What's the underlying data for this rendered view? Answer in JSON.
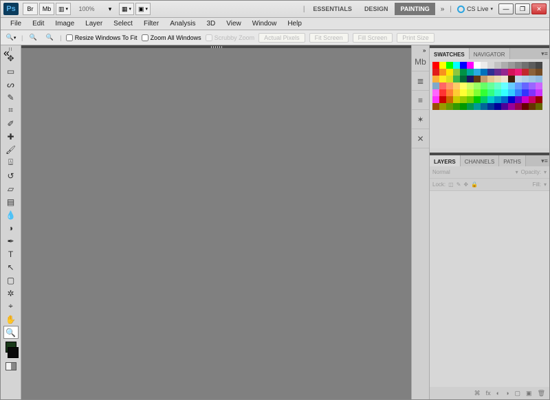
{
  "app": {
    "logo": "Ps"
  },
  "titlebar": {
    "zoom_value": "100%",
    "workspaces": [
      "ESSENTIALS",
      "DESIGN",
      "PAINTING"
    ],
    "active_workspace": 2,
    "cslive_label": "CS Live"
  },
  "menus": [
    "File",
    "Edit",
    "Image",
    "Layer",
    "Select",
    "Filter",
    "Analysis",
    "3D",
    "View",
    "Window",
    "Help"
  ],
  "options": {
    "resize_label": "Resize Windows To Fit",
    "zoom_all_label": "Zoom All Windows",
    "scrubby_label": "Scrubby Zoom",
    "buttons": [
      "Actual Pixels",
      "Fit Screen",
      "Fill Screen",
      "Print Size"
    ]
  },
  "tools": {
    "items": [
      {
        "name": "move-tool",
        "glyph": "✥"
      },
      {
        "name": "marquee-tool",
        "glyph": "▭"
      },
      {
        "name": "lasso-tool",
        "glyph": "ᔕ"
      },
      {
        "name": "quick-select-tool",
        "glyph": "✎"
      },
      {
        "name": "crop-tool",
        "glyph": "⌗"
      },
      {
        "name": "eyedropper-tool",
        "glyph": "✐"
      },
      {
        "name": "healing-tool",
        "glyph": "✚"
      },
      {
        "name": "brush-tool",
        "glyph": "🖌"
      },
      {
        "name": "stamp-tool",
        "glyph": "⍍"
      },
      {
        "name": "history-brush-tool",
        "glyph": "↺"
      },
      {
        "name": "eraser-tool",
        "glyph": "▱"
      },
      {
        "name": "gradient-tool",
        "glyph": "▤"
      },
      {
        "name": "blur-tool",
        "glyph": "💧"
      },
      {
        "name": "dodge-tool",
        "glyph": "◑"
      },
      {
        "name": "pen-tool",
        "glyph": "✒"
      },
      {
        "name": "type-tool",
        "glyph": "T"
      },
      {
        "name": "path-select-tool",
        "glyph": "↖"
      },
      {
        "name": "shape-tool",
        "glyph": "▢"
      },
      {
        "name": "3d-tool",
        "glyph": "✲"
      },
      {
        "name": "3d-camera-tool",
        "glyph": "⌖"
      },
      {
        "name": "hand-tool",
        "glyph": "✋"
      },
      {
        "name": "zoom-tool",
        "glyph": "🔍"
      }
    ],
    "selected": 21,
    "fg_color": "#1a3a1a",
    "bg_color": "#0a0a0a"
  },
  "dock_icons": [
    {
      "name": "mini-bridge-icon",
      "glyph": "Mb"
    },
    {
      "name": "history-panel-icon",
      "glyph": "≣"
    },
    {
      "name": "brush-presets-icon",
      "glyph": "≡"
    },
    {
      "name": "brush-panel-icon",
      "glyph": "✶"
    },
    {
      "name": "tool-presets-icon",
      "glyph": "✕"
    }
  ],
  "swatches_panel": {
    "tabs": [
      "SWATCHES",
      "NAVIGATOR"
    ],
    "active": 0,
    "colors": [
      "#ff0000",
      "#ffff00",
      "#00ff00",
      "#00ffff",
      "#0000ff",
      "#ff00ff",
      "#ffffff",
      "#ebebeb",
      "#d6d6d6",
      "#c2c2c2",
      "#adadad",
      "#999999",
      "#858585",
      "#707070",
      "#5c5c5c",
      "#474747",
      "#e11b1b",
      "#f7931e",
      "#ffe600",
      "#8cc63f",
      "#009245",
      "#00a99d",
      "#29abe2",
      "#0071bc",
      "#2e3192",
      "#662d91",
      "#93278f",
      "#d4145a",
      "#ed1e79",
      "#c1272d",
      "#8c6239",
      "#754c24",
      "#fbb03b",
      "#fcee21",
      "#d9e021",
      "#39b54a",
      "#006837",
      "#1b1464",
      "#603813",
      "#c69c6d",
      "#e6c88f",
      "#e8d9b0",
      "#eee3cd",
      "#42210b",
      "#c1d8e8",
      "#b0cfe6",
      "#a0c6e4",
      "#90bce2",
      "#7fa8c9",
      "#ff6666",
      "#ff9966",
      "#ffcc66",
      "#ffff66",
      "#ccff66",
      "#99ff66",
      "#66ff66",
      "#66ff99",
      "#66ffcc",
      "#66ffff",
      "#66ccff",
      "#6699ff",
      "#6666ff",
      "#9966ff",
      "#cc66ff",
      "#ff66ff",
      "#ff3333",
      "#ff8033",
      "#ffcc33",
      "#ffff33",
      "#ccff33",
      "#80ff33",
      "#33ff33",
      "#33ff80",
      "#33ffcc",
      "#33ffff",
      "#33ccff",
      "#3380ff",
      "#3333ff",
      "#8033ff",
      "#cc33ff",
      "#ff33ff",
      "#cc0000",
      "#cc6600",
      "#cccc00",
      "#99cc00",
      "#66cc00",
      "#00cc00",
      "#00cc66",
      "#00cccc",
      "#0099cc",
      "#0066cc",
      "#0000cc",
      "#6600cc",
      "#cc00cc",
      "#cc0066",
      "#990000",
      "#994c00",
      "#999900",
      "#669900",
      "#339900",
      "#009900",
      "#00994c",
      "#009999",
      "#006699",
      "#003399",
      "#000099",
      "#4c0099",
      "#990099",
      "#99004c",
      "#660000",
      "#663300",
      "#666600"
    ]
  },
  "layers_panel": {
    "tabs": [
      "LAYERS",
      "CHANNELS",
      "PATHS"
    ],
    "active": 0,
    "blend_mode": "Normal",
    "opacity_label": "Opacity:",
    "lock_label": "Lock:",
    "fill_label": "Fill:"
  }
}
